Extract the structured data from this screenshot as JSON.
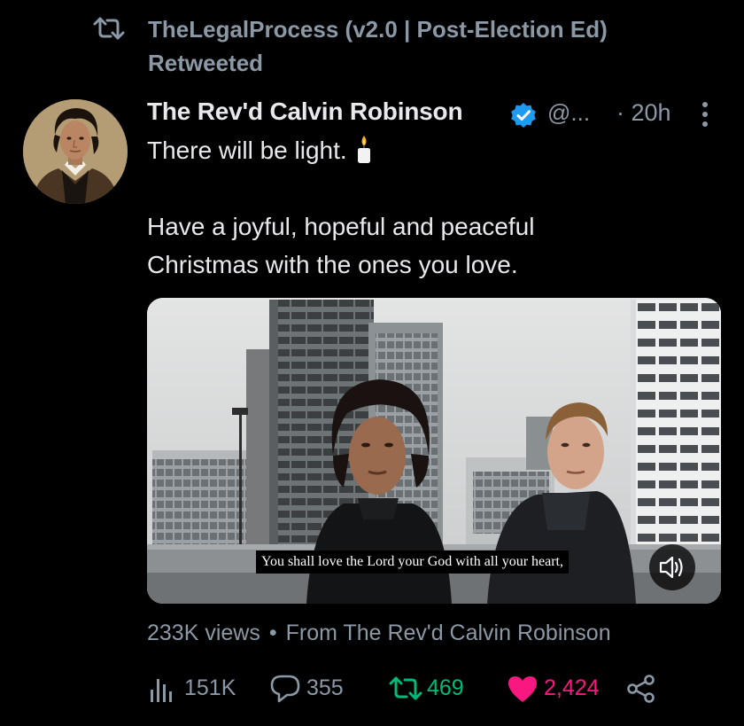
{
  "retweet_context": {
    "retweeter": "TheLegalProcess (v2.0 | Post-Election Ed)",
    "label": "Retweeted"
  },
  "tweet": {
    "author_name": "The Rev'd Calvin Robinson",
    "handle": "@...",
    "time": "· 20h",
    "text_line_1": "There will be light.",
    "text_line_2": "Have a joyful, hopeful and peaceful",
    "text_line_3": "Christmas with the ones you love.",
    "media": {
      "subtitle": "You shall love the Lord your God with all your heart,"
    },
    "views": "233K views",
    "from": "From The Rev'd Calvin Robinson"
  },
  "actions": {
    "analytics_count": "151K",
    "reply_count": "355",
    "retweet_count": "469",
    "like_count": "2,424"
  },
  "icons": {
    "retweet_context": "retweet-icon",
    "verified": "verified-badge-icon",
    "more": "more-options-icon",
    "candle": "candle-icon",
    "volume": "speaker-icon",
    "analytics": "analytics-bars-icon",
    "reply": "reply-bubble-icon",
    "retweet": "retweet-icon",
    "like": "heart-filled-icon",
    "share": "share-icon"
  },
  "colors": {
    "background": "#000000",
    "text": "#e7e9ea",
    "muted": "#8b98a5",
    "verified": "#1d9bf0",
    "retweeted_green": "#00ba7c",
    "liked_pink": "#f91880"
  }
}
